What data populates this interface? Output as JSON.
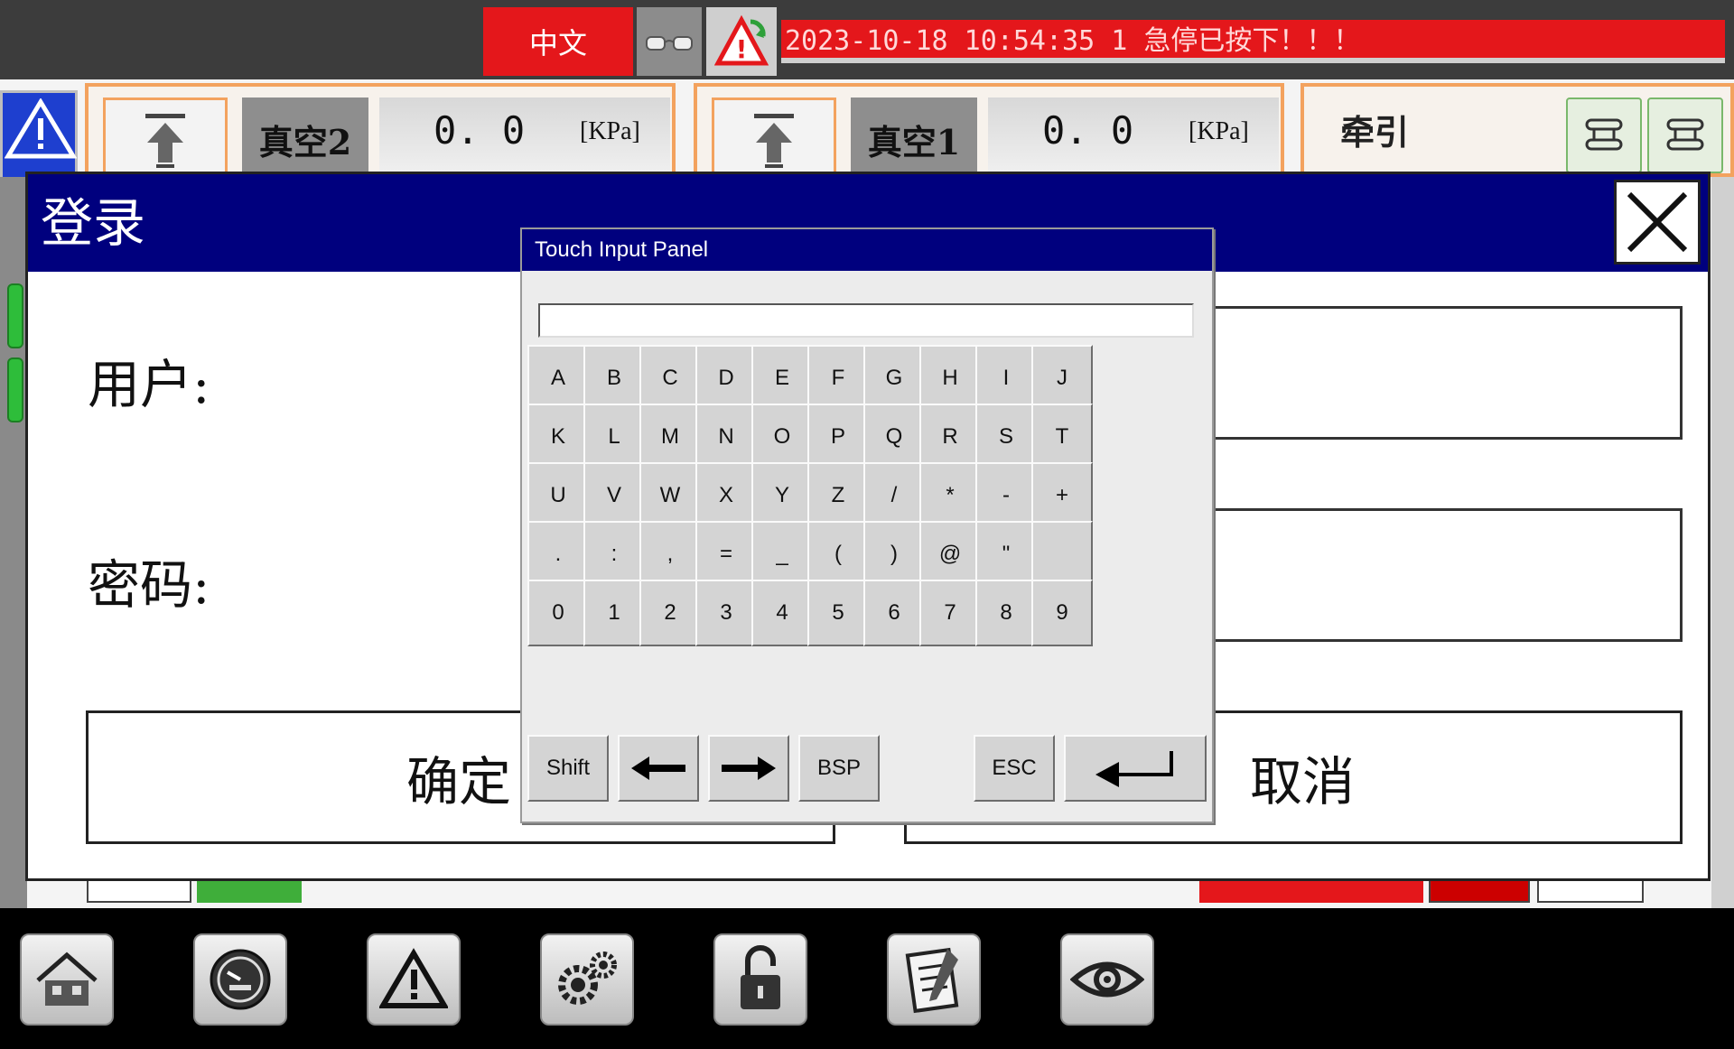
{
  "topbar": {
    "language_label": "中文",
    "alarm_text": "2023-10-18 10:54:35  1 急停已按下！！！"
  },
  "panels": [
    {
      "tag": "真空2",
      "value": "0. 0",
      "unit": "[KPa]"
    },
    {
      "tag": "真空1",
      "value": "0. 0",
      "unit": "[KPa]"
    }
  ],
  "traction": {
    "label": "牵引"
  },
  "login": {
    "title": "登录",
    "user_label": "用户:",
    "password_label": "密码:",
    "ok_label": "确定",
    "cancel_label": "取消"
  },
  "touch_panel": {
    "title": "Touch Input Panel",
    "input_value": "",
    "rows": [
      [
        "A",
        "B",
        "C",
        "D",
        "E",
        "F",
        "G",
        "H",
        "I",
        "J"
      ],
      [
        "K",
        "L",
        "M",
        "N",
        "O",
        "P",
        "Q",
        "R",
        "S",
        "T"
      ],
      [
        "U",
        "V",
        "W",
        "X",
        "Y",
        "Z",
        "/",
        "*",
        "-",
        "+"
      ],
      [
        ".",
        ":",
        ",",
        "=",
        "_",
        "(",
        ")",
        "@",
        "\"",
        ""
      ],
      [
        "0",
        "1",
        "2",
        "3",
        "4",
        "5",
        "6",
        "7",
        "8",
        "9"
      ]
    ],
    "bottom_keys": {
      "shift": "Shift",
      "left": "←",
      "right": "→",
      "backspace": "BSP",
      "escape": "ESC",
      "enter": "↵"
    }
  },
  "icons": {
    "bottom_nav": [
      "home-icon",
      "gauge-icon",
      "warning-icon",
      "settings-gears-icon",
      "unlock-icon",
      "notepad-icon",
      "eye-icon"
    ]
  },
  "colors": {
    "title_bar": "#00007e",
    "alarm": "#e4171b",
    "accent_orange": "#f3a25e"
  }
}
